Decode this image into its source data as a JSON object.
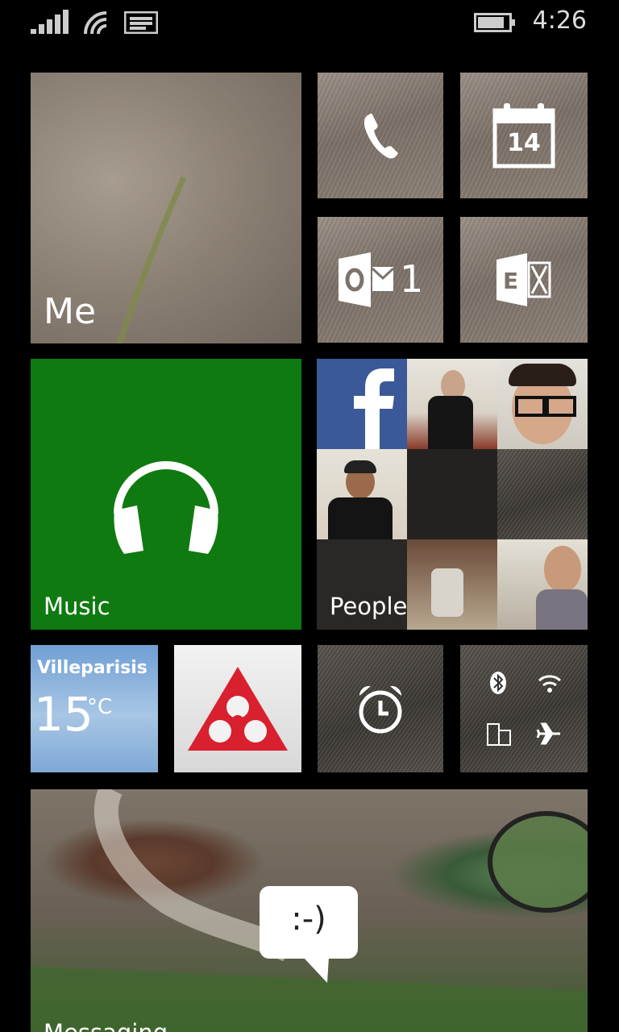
{
  "status_bar": {
    "time": "4:26",
    "signal_icon": "signal-icon",
    "wifi_icon": "wifi-icon",
    "message_icon": "message-notification-icon",
    "battery_icon": "battery-icon"
  },
  "tiles": {
    "me": {
      "label": "Me"
    },
    "phone": {
      "icon": "phone-icon"
    },
    "calendar": {
      "day": "14",
      "icon": "calendar-icon"
    },
    "outlook": {
      "count": "1",
      "icon": "outlook-icon"
    },
    "exchange": {
      "icon": "exchange-icon"
    },
    "music": {
      "label": "Music",
      "icon": "headphones-icon",
      "color": "#0f7a10"
    },
    "people": {
      "label": "People"
    },
    "weather": {
      "city": "Villeparisis",
      "temperature": "15",
      "unit": "°C"
    },
    "bank": {
      "icon": "bank-logo-icon"
    },
    "alarms": {
      "icon": "alarm-clock-icon"
    },
    "settings": {
      "icons": [
        "bluetooth-icon",
        "wifi-icon",
        "rotation-lock-icon",
        "airplane-icon"
      ]
    },
    "messaging": {
      "label": "Messaging",
      "emoticon": ":-)"
    }
  },
  "colors": {
    "background": "#000000",
    "music_green": "#0f7a10",
    "bank_red": "#d8202e"
  }
}
